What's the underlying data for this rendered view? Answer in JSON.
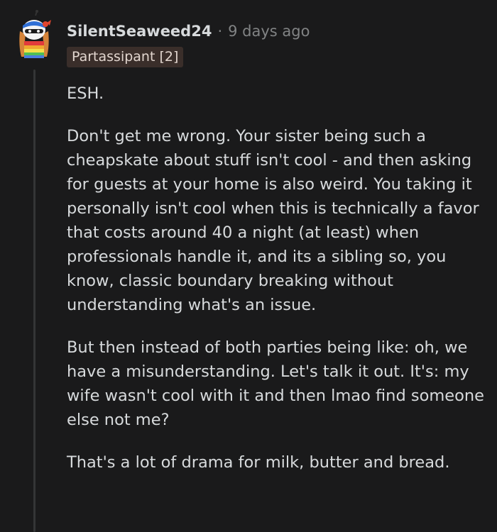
{
  "comment": {
    "author": "SilentSeaweed24",
    "separator": "·",
    "timestamp": "9 days ago",
    "flair": "Partassipant [2]",
    "avatar_icon": "snoo-avatar-icon",
    "paragraphs": [
      "ESH.",
      "Don't get me wrong. Your sister being such a cheapskate about stuff isn't cool - and then asking for guests at your home is also weird. You taking it personally isn't cool when this is technically a favor that costs around 40 a night (at least) when professionals handle it, and its a sibling so, you know, classic boundary breaking without understanding what's an issue.",
      "But then instead of both parties being like: oh, we have a misunderstanding. Let's talk it out. It's: my wife wasn't cool with it and then lmao find someone else not me?",
      "That's a lot of drama for milk, butter and bread."
    ]
  },
  "colors": {
    "background": "#1a1a1b",
    "text": "#d7dadc",
    "meta": "#818384",
    "flair_bg": "#3a2e2a",
    "thread_line": "#343536"
  }
}
